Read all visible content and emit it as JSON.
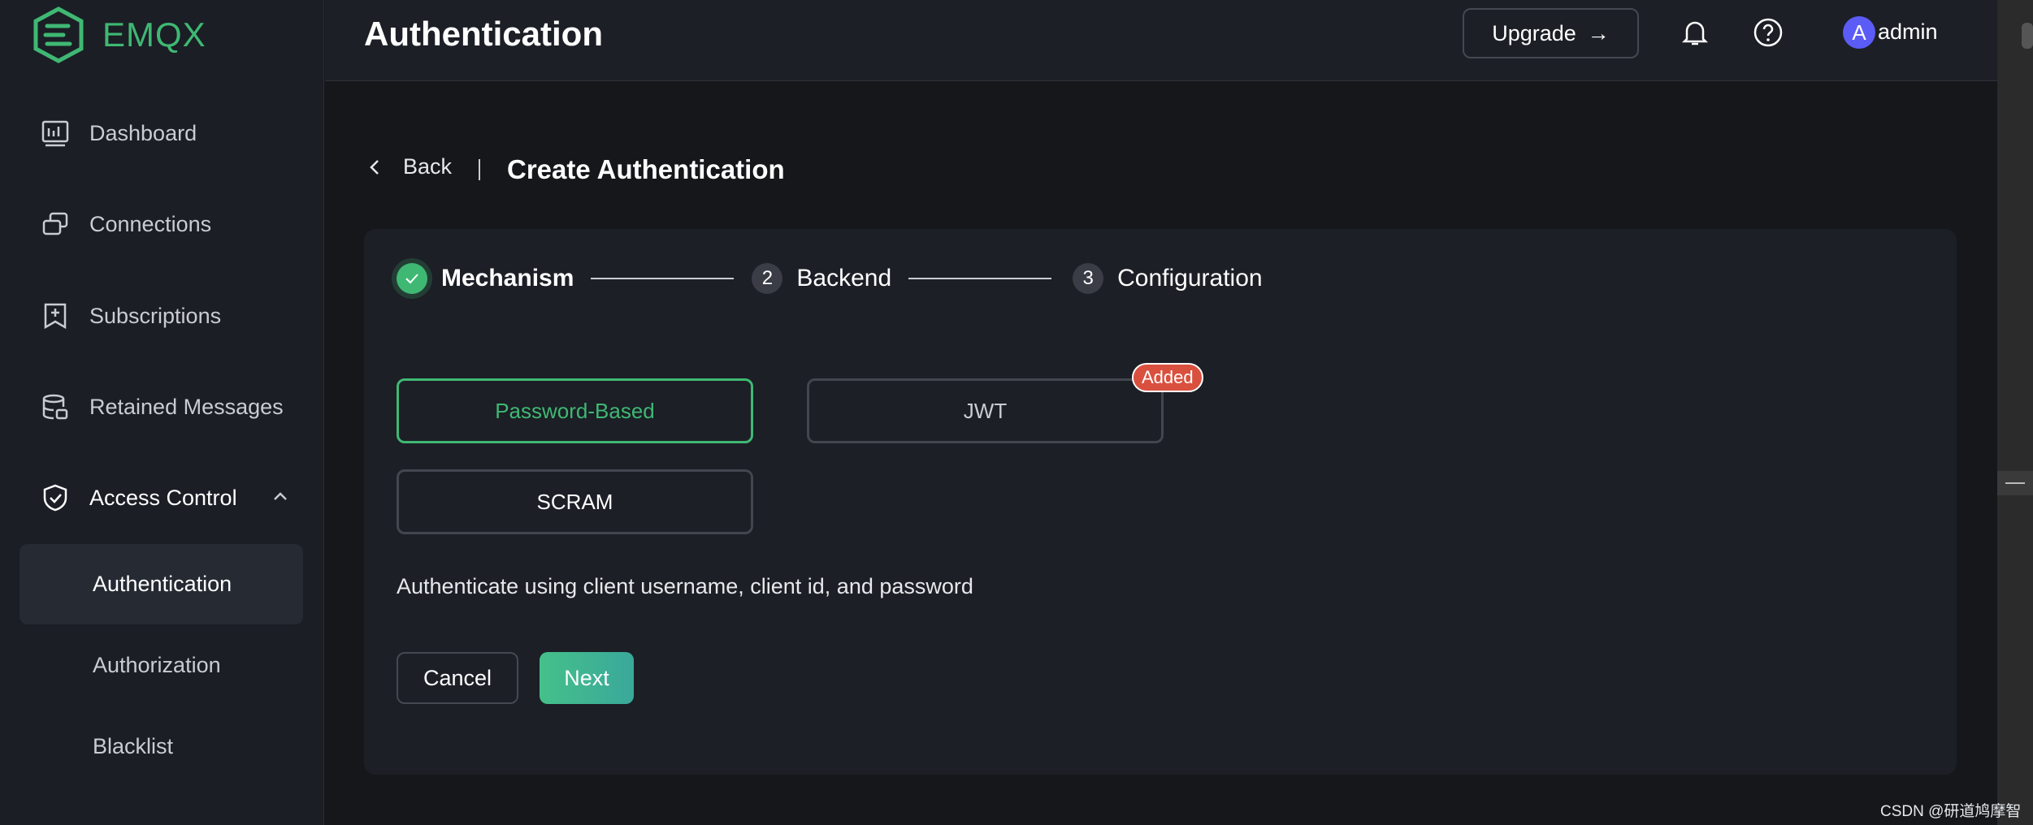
{
  "brand": {
    "name": "EMQX",
    "color": "#3fb873"
  },
  "sidebar": {
    "items": [
      {
        "label": "Dashboard",
        "icon": "dashboard-icon"
      },
      {
        "label": "Connections",
        "icon": "connections-icon"
      },
      {
        "label": "Subscriptions",
        "icon": "subscriptions-icon"
      },
      {
        "label": "Retained Messages",
        "icon": "database-icon"
      },
      {
        "label": "Access Control",
        "icon": "shield-icon",
        "expanded": true
      }
    ],
    "sub_items": [
      {
        "label": "Authentication",
        "active": true
      },
      {
        "label": "Authorization"
      },
      {
        "label": "Blacklist"
      }
    ]
  },
  "header": {
    "title": "Authentication",
    "upgrade_label": "Upgrade",
    "avatar_letter": "A",
    "username": "admin"
  },
  "page": {
    "back_label": "Back",
    "title": "Create Authentication"
  },
  "steps": [
    {
      "label": "Mechanism",
      "status": "done"
    },
    {
      "number": "2",
      "label": "Backend",
      "status": "pending"
    },
    {
      "number": "3",
      "label": "Configuration",
      "status": "pending"
    }
  ],
  "mechanisms": [
    {
      "label": "Password-Based",
      "selected": true
    },
    {
      "label": "JWT",
      "badge": "Added"
    },
    {
      "label": "SCRAM"
    }
  ],
  "description": "Authenticate using client username, client id, and password",
  "actions": {
    "cancel": "Cancel",
    "next": "Next"
  },
  "watermark": "CSDN @研道鸠摩智",
  "colors": {
    "accent": "#3fb873",
    "badge": "#d9503f",
    "avatar": "#5b5cf6"
  }
}
